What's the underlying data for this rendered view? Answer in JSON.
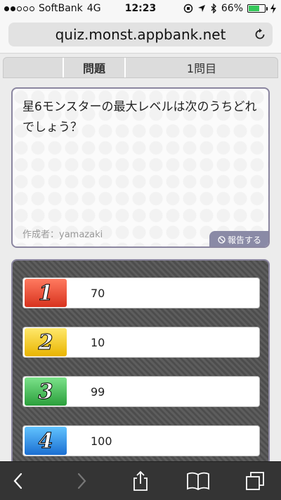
{
  "status_bar": {
    "carrier": "SoftBank",
    "network": "4G",
    "time": "12:23",
    "battery": "66%",
    "battery_level": 0.66
  },
  "browser": {
    "url": "quiz.monst.appbank.net"
  },
  "quiz": {
    "tab_title": "問題",
    "tab_number": "1問目",
    "question": "星6モンスターの最大レベルは次のうちどれでしょう？",
    "author": "作成者：yamazaki",
    "report_label": "報告する",
    "answers": [
      {
        "badge": "1",
        "value": "70"
      },
      {
        "badge": "2",
        "value": "10"
      },
      {
        "badge": "3",
        "value": "99"
      },
      {
        "badge": "4",
        "value": "100"
      }
    ]
  },
  "colors": {
    "badge_1": "#e2412a",
    "badge_2": "#f2c400",
    "badge_3": "#3cb04a",
    "badge_4": "#2f86e0",
    "panel_border": "#8b86a0"
  }
}
